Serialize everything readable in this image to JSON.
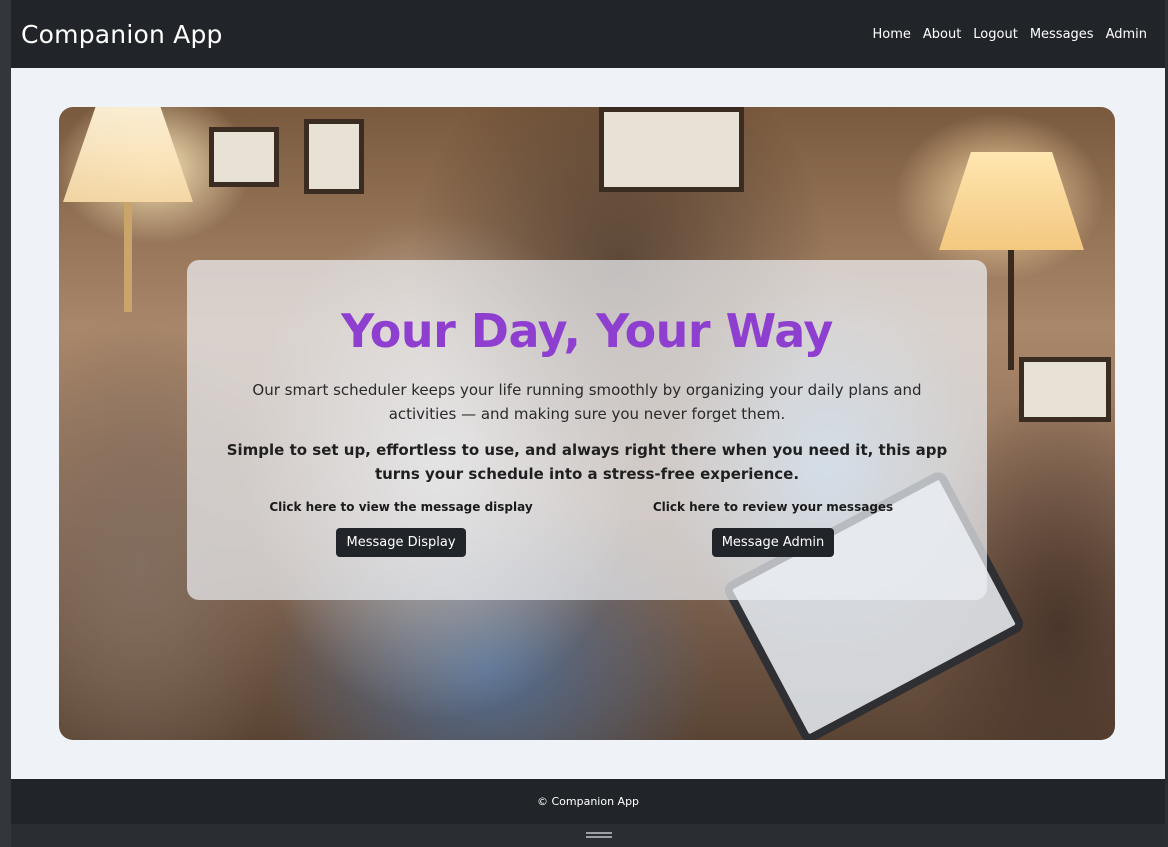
{
  "app": {
    "brand": "Companion App"
  },
  "nav": {
    "items": [
      {
        "label": "Home"
      },
      {
        "label": "About"
      },
      {
        "label": "Logout"
      },
      {
        "label": "Messages"
      },
      {
        "label": "Admin"
      }
    ]
  },
  "hero": {
    "headline": "Your Day, Your Way",
    "intro": "Our smart scheduler keeps your life running smoothly by organizing your daily plans and activities — and making sure you never forget them.",
    "emphasis": "Simple to set up, effortless to use, and always right there when you need it, this app turns your schedule into a stress-free experience.",
    "cta_left": {
      "label": "Click here to view the message display",
      "button": "Message Display"
    },
    "cta_right": {
      "label": "Click here to review your messages",
      "button": "Message Admin"
    },
    "image_icon": "photo-elderly-woman-and-nurse-with-tablet"
  },
  "footer": {
    "text": "© Companion App"
  },
  "colors": {
    "navbar": "#212529",
    "page_bg": "#eff2f7",
    "headline": "#8e3fd0",
    "button_bg": "#212529"
  }
}
